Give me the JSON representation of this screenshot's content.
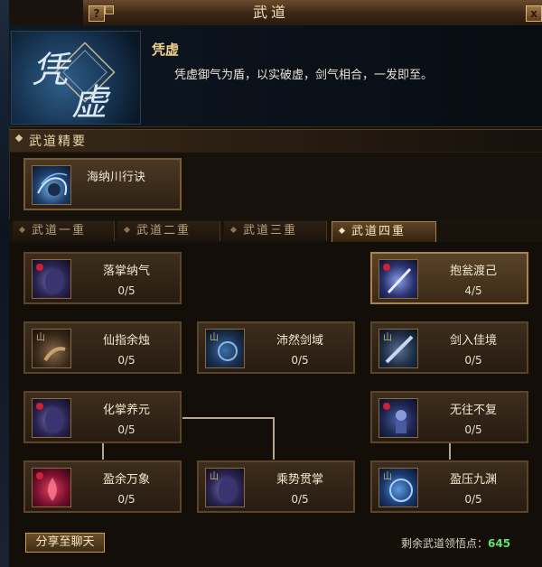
{
  "window": {
    "title": "武道",
    "help_label": "?",
    "close_label": "x"
  },
  "header": {
    "emblem_text": "凭虚",
    "skill_name": "凭虚",
    "description": "凭虚御气为盾，以实破虚，剑气相合，一发即至。"
  },
  "essentials": {
    "label": "武道精要",
    "item": {
      "name": "海纳川行诀",
      "icon": "water-palm-icon"
    }
  },
  "tabs": [
    {
      "label": "武道一重",
      "active": false
    },
    {
      "label": "武道二重",
      "active": false
    },
    {
      "label": "武道三重",
      "active": false
    },
    {
      "label": "武道四重",
      "active": true
    }
  ],
  "nodes": [
    {
      "name": "落掌纳气",
      "level": "0/5",
      "icon": "palm-icon",
      "active": false
    },
    {
      "name": "抱瓮渡己",
      "level": "4/5",
      "icon": "sword-light-icon",
      "active": true
    },
    {
      "name": "仙指余烛",
      "level": "0/5",
      "icon": "finger-icon",
      "active": false
    },
    {
      "name": "沛然剑域",
      "level": "0/5",
      "icon": "sword-field-icon",
      "active": false
    },
    {
      "name": "剑入佳境",
      "level": "0/5",
      "icon": "sword-icon",
      "active": false
    },
    {
      "name": "化掌养元",
      "level": "0/5",
      "icon": "palm-icon",
      "active": false
    },
    {
      "name": "无往不复",
      "level": "0/5",
      "icon": "figure-icon",
      "active": false
    },
    {
      "name": "盈余万象",
      "level": "0/5",
      "icon": "red-flame-icon",
      "active": false
    },
    {
      "name": "乘势贯掌",
      "level": "0/5",
      "icon": "palm-icon",
      "active": false
    },
    {
      "name": "盈压九渊",
      "level": "0/5",
      "icon": "blue-aura-icon",
      "active": false
    }
  ],
  "footer": {
    "share_label": "分享至聊天",
    "remaining_label": "剩余武道领悟点：",
    "remaining_value": "645"
  },
  "colors": {
    "gold_text": "#f2d48e",
    "green_value": "#5be26d",
    "border_active": "#a9834d"
  }
}
